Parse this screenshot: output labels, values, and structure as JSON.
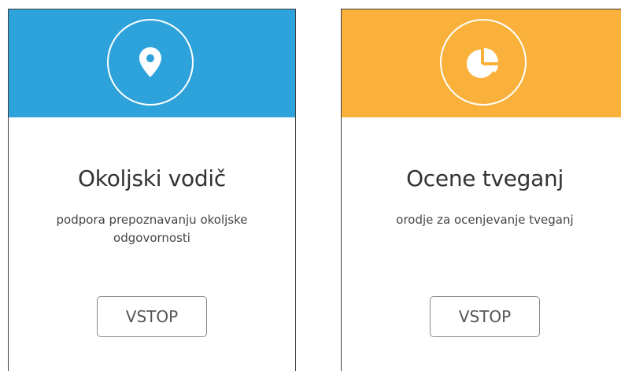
{
  "colors": {
    "blue": "#2ea3db",
    "orange": "#f9b13b"
  },
  "cards": [
    {
      "icon": "map-marker-icon",
      "title": "Okoljski vodič",
      "subtitle": "podpora prepoznavanju okoljske odgovornosti",
      "button_label": "VSTOP"
    },
    {
      "icon": "pie-chart-icon",
      "title": "Ocene tveganj",
      "subtitle": "orodje za ocenjevanje tveganj",
      "button_label": "VSTOP"
    }
  ]
}
